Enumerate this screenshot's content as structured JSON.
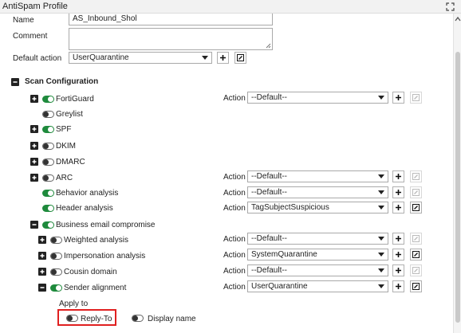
{
  "window": {
    "title": "AntiSpam Profile",
    "expand_icon": "expand-icon"
  },
  "form": {
    "name_label": "Name",
    "name_value": "AS_Inbound_Shol",
    "comment_label": "Comment",
    "comment_value": "",
    "default_action_label": "Default action",
    "default_action_value": "UserQuarantine"
  },
  "scan_config": {
    "title": "Scan Configuration",
    "action_label": "Action",
    "items": [
      {
        "label": "FortiGuard",
        "enabled": true,
        "action": "--Default--"
      },
      {
        "label": "Greylist",
        "enabled": false
      },
      {
        "label": "SPF",
        "enabled": true
      },
      {
        "label": "DKIM",
        "enabled": false
      },
      {
        "label": "DMARC",
        "enabled": false
      },
      {
        "label": "ARC",
        "enabled": false,
        "action": "--Default--"
      },
      {
        "label": "Behavior analysis",
        "enabled": true,
        "action": "--Default--"
      },
      {
        "label": "Header analysis",
        "enabled": true,
        "action": "TagSubjectSuspicious"
      },
      {
        "label": "Business email compromise",
        "enabled": true
      },
      {
        "label": "Weighted analysis",
        "enabled": false,
        "action": "--Default--"
      },
      {
        "label": "Impersonation analysis",
        "enabled": false,
        "action": "SystemQuarantine"
      },
      {
        "label": "Cousin domain",
        "enabled": false,
        "action": "--Default--"
      },
      {
        "label": "Sender alignment",
        "enabled": true,
        "action": "UserQuarantine"
      }
    ],
    "apply_to": {
      "label": "Apply to",
      "options": [
        {
          "label": "Reply-To",
          "enabled": false,
          "highlighted": true
        },
        {
          "label": "Display name",
          "enabled": false
        }
      ]
    }
  },
  "colors": {
    "toggle_on": "#1e8a3c",
    "highlight": "#e02020"
  }
}
